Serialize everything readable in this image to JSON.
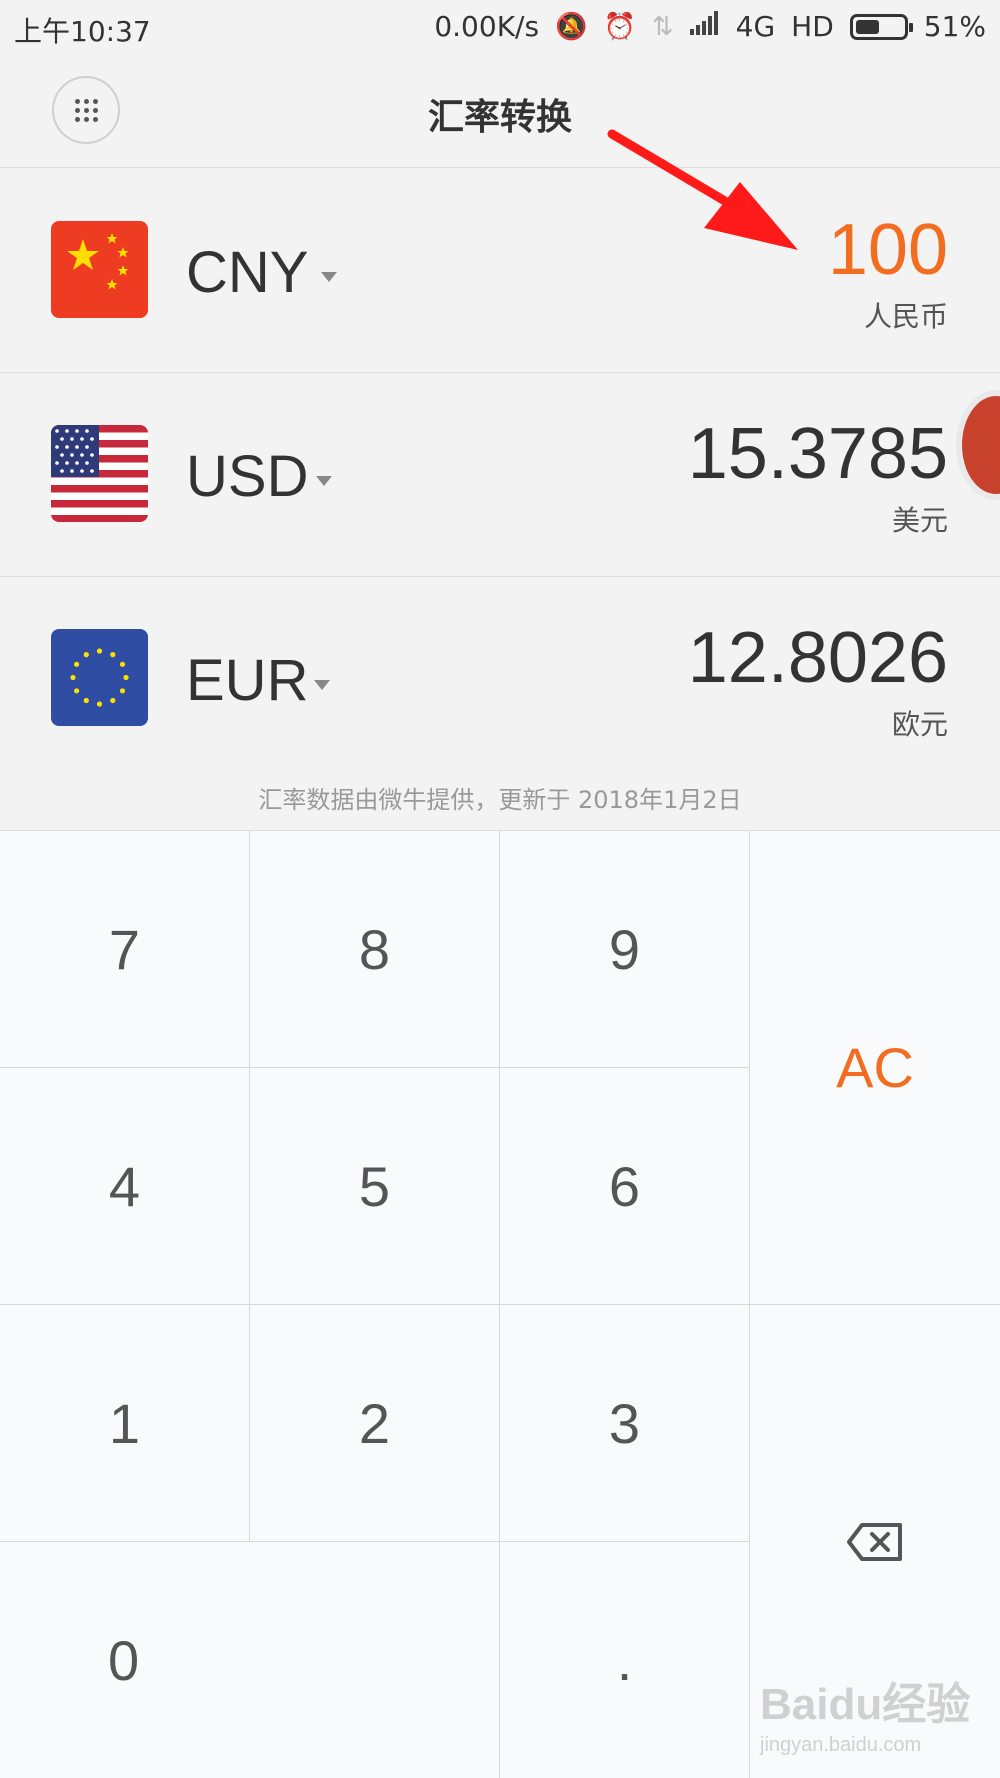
{
  "status_bar": {
    "time": "上午10:37",
    "speed": "0.00K/s",
    "network": "4G",
    "hd": "HD",
    "battery": "51%",
    "battery_level": 0.51,
    "icons": [
      "mute-icon",
      "alarm-icon",
      "data-transfer-icon",
      "signal-icon",
      "battery-icon"
    ]
  },
  "header": {
    "title": "汇率转换",
    "menu_icon": "grid-menu-icon"
  },
  "currencies": [
    {
      "code": "CNY",
      "amount": "100",
      "name": "人民币",
      "active": true,
      "flag_icon": "china-flag-icon"
    },
    {
      "code": "USD",
      "amount": "15.3785",
      "name": "美元",
      "active": false,
      "flag_icon": "usa-flag-icon"
    },
    {
      "code": "EUR",
      "amount": "12.8026",
      "name": "欧元",
      "active": false,
      "flag_icon": "eu-flag-icon"
    }
  ],
  "note": "汇率数据由微牛提供，更新于 2018年1月2日",
  "keypad": {
    "keys": [
      "7",
      "8",
      "9",
      "4",
      "5",
      "6",
      "1",
      "2",
      "3",
      "0",
      "."
    ],
    "clear": "AC",
    "backspace_icon": "backspace-icon"
  },
  "watermark": {
    "text": "Baidu经验",
    "url": "jingyan.baidu.com"
  },
  "colors": {
    "accent": "#f36d21",
    "background": "#f3f3f3",
    "keypad_bg": "#f9fafb",
    "arrow": "#ff1a1a"
  }
}
